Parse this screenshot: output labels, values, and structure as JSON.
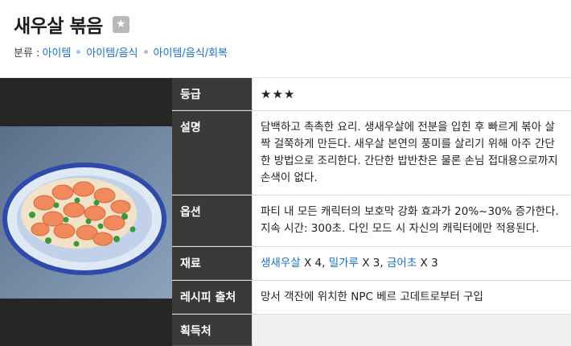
{
  "page": {
    "title": "새우살 볶음",
    "star_button_icon": "star-icon"
  },
  "categories": {
    "label": "분류 :",
    "items": [
      "아이템",
      "아이템/음식",
      "아이템/음식/회복"
    ]
  },
  "table": {
    "rows": [
      {
        "header": "등급",
        "value": "★★★"
      },
      {
        "header": "설명",
        "value": "담백하고 촉촉한 요리. 생새우살에 전분을 입힌 후 빠르게 볶아 살짝 걸쭉하게 만든다. 새우살 본연의 풍미를 살리기 위해 아주 간단한 방법으로 조리한다. 간단한 밥반찬은 물론 손님 접대용으로까지 손색이 없다."
      },
      {
        "header": "옵션",
        "value": "파티 내 모든 캐릭터의 보호막 강화 효과가 20%~30% 증가한다. 지속 시간: 300초. 다인 모드 시 자신의 캐릭터에만 적용된다."
      },
      {
        "header": "재료",
        "materials": [
          {
            "name": "생새우살",
            "qty": "X 4,"
          },
          {
            "name": "밀가루",
            "qty": "X 3,"
          },
          {
            "name": "금어초",
            "qty": "X 3"
          }
        ]
      },
      {
        "header": "레시피 출처",
        "value": "망서 객잔에 위치한 NPC 베르 고데트로부터 구입"
      },
      {
        "header": "획득처",
        "value": ""
      }
    ]
  },
  "colors": {
    "link": "#1a6fc9",
    "header_bg": "#3a3a3a",
    "plate_rim": "#3a55b0"
  }
}
